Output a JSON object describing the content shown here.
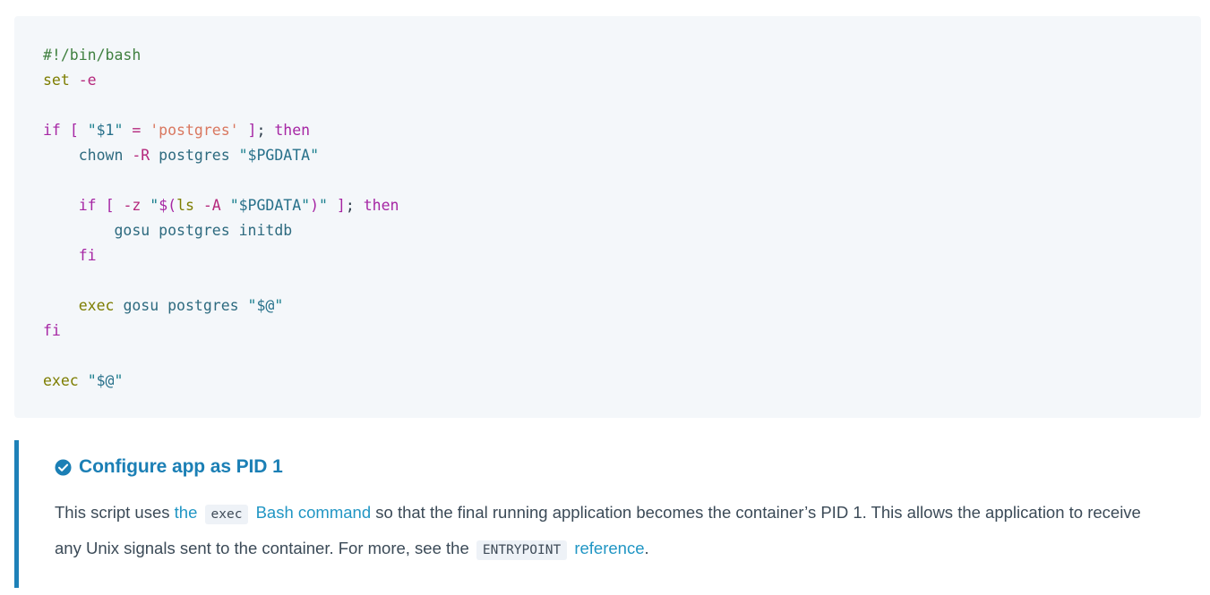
{
  "code_block": {
    "language": "bash",
    "background": "#f4f7fa",
    "lines": [
      [
        {
          "t": "#!/bin/bash",
          "c": "comment"
        }
      ],
      [
        {
          "t": "set",
          "c": "builtin"
        },
        {
          "t": " ",
          "c": "plain"
        },
        {
          "t": "-e",
          "c": "flag"
        }
      ],
      [],
      [
        {
          "t": "if",
          "c": "keyword"
        },
        {
          "t": " ",
          "c": "plain"
        },
        {
          "t": "[",
          "c": "paren"
        },
        {
          "t": " ",
          "c": "plain"
        },
        {
          "t": "\"",
          "c": "string"
        },
        {
          "t": "$1",
          "c": "var"
        },
        {
          "t": "\"",
          "c": "string"
        },
        {
          "t": " ",
          "c": "plain"
        },
        {
          "t": "=",
          "c": "flag"
        },
        {
          "t": " ",
          "c": "plain"
        },
        {
          "t": "'postgres'",
          "c": "sq"
        },
        {
          "t": " ",
          "c": "plain"
        },
        {
          "t": "]",
          "c": "paren"
        },
        {
          "t": ";",
          "c": "plain"
        },
        {
          "t": " ",
          "c": "plain"
        },
        {
          "t": "then",
          "c": "keyword"
        }
      ],
      [
        {
          "t": "    ",
          "c": "plain"
        },
        {
          "t": "chown",
          "c": "cmd"
        },
        {
          "t": " ",
          "c": "plain"
        },
        {
          "t": "-R",
          "c": "flag"
        },
        {
          "t": " ",
          "c": "plain"
        },
        {
          "t": "postgres",
          "c": "cmd"
        },
        {
          "t": " ",
          "c": "plain"
        },
        {
          "t": "\"",
          "c": "string"
        },
        {
          "t": "$PGDATA",
          "c": "var"
        },
        {
          "t": "\"",
          "c": "string"
        }
      ],
      [],
      [
        {
          "t": "    ",
          "c": "plain"
        },
        {
          "t": "if",
          "c": "keyword"
        },
        {
          "t": " ",
          "c": "plain"
        },
        {
          "t": "[",
          "c": "paren"
        },
        {
          "t": " ",
          "c": "plain"
        },
        {
          "t": "-z",
          "c": "flag"
        },
        {
          "t": " ",
          "c": "plain"
        },
        {
          "t": "\"",
          "c": "string"
        },
        {
          "t": "$(",
          "c": "paren"
        },
        {
          "t": "ls",
          "c": "builtin"
        },
        {
          "t": " ",
          "c": "plain"
        },
        {
          "t": "-A",
          "c": "flag"
        },
        {
          "t": " ",
          "c": "plain"
        },
        {
          "t": "\"",
          "c": "string"
        },
        {
          "t": "$PGDATA",
          "c": "var"
        },
        {
          "t": "\"",
          "c": "string"
        },
        {
          "t": ")",
          "c": "paren"
        },
        {
          "t": "\"",
          "c": "string"
        },
        {
          "t": " ",
          "c": "plain"
        },
        {
          "t": "]",
          "c": "paren"
        },
        {
          "t": ";",
          "c": "plain"
        },
        {
          "t": " ",
          "c": "plain"
        },
        {
          "t": "then",
          "c": "keyword"
        }
      ],
      [
        {
          "t": "        ",
          "c": "plain"
        },
        {
          "t": "gosu",
          "c": "cmd"
        },
        {
          "t": " ",
          "c": "plain"
        },
        {
          "t": "postgres",
          "c": "cmd"
        },
        {
          "t": " ",
          "c": "plain"
        },
        {
          "t": "initdb",
          "c": "cmd"
        }
      ],
      [
        {
          "t": "    ",
          "c": "plain"
        },
        {
          "t": "fi",
          "c": "keyword"
        }
      ],
      [],
      [
        {
          "t": "    ",
          "c": "plain"
        },
        {
          "t": "exec",
          "c": "exec"
        },
        {
          "t": " ",
          "c": "plain"
        },
        {
          "t": "gosu",
          "c": "cmd"
        },
        {
          "t": " ",
          "c": "plain"
        },
        {
          "t": "postgres",
          "c": "cmd"
        },
        {
          "t": " ",
          "c": "plain"
        },
        {
          "t": "\"",
          "c": "string"
        },
        {
          "t": "$@",
          "c": "var"
        },
        {
          "t": "\"",
          "c": "string"
        }
      ],
      [
        {
          "t": "fi",
          "c": "keyword"
        }
      ],
      [],
      [
        {
          "t": "exec",
          "c": "exec"
        },
        {
          "t": " ",
          "c": "plain"
        },
        {
          "t": "\"",
          "c": "string"
        },
        {
          "t": "$@",
          "c": "var"
        },
        {
          "t": "\"",
          "c": "string"
        }
      ]
    ]
  },
  "callout": {
    "icon": "check-circle-icon",
    "accent_color": "#1e81b8",
    "title": "Configure app as PID 1",
    "title_color": "#1b7fb5",
    "body": [
      {
        "type": "text",
        "value": "This script uses "
      },
      {
        "type": "link_start",
        "value": "the"
      },
      {
        "type": "link_code",
        "value": "exec"
      },
      {
        "type": "link_end",
        "value": "Bash command"
      },
      {
        "type": "text",
        "value": " so that the final running application becomes the container’s PID 1. This allows the application to receive any Unix signals sent to the container. For more, see the "
      },
      {
        "type": "link_code2",
        "value": "ENTRYPOINT"
      },
      {
        "type": "link_tail",
        "value": "reference"
      },
      {
        "type": "text",
        "value": "."
      }
    ],
    "link_color": "#2196c4"
  }
}
